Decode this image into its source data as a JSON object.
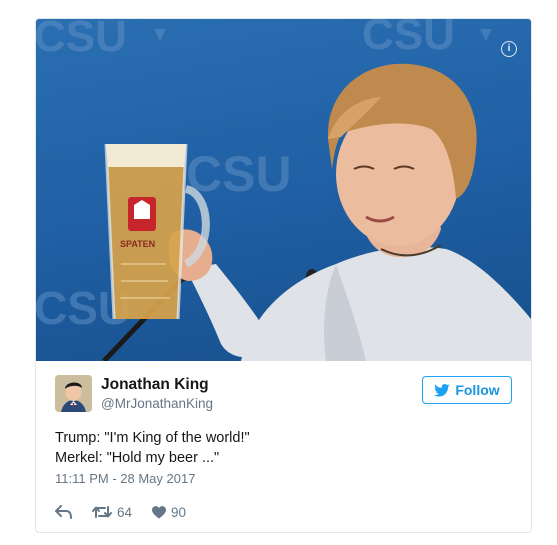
{
  "tweet": {
    "author_name": "Jonathan King",
    "author_handle": "@MrJonathanKing",
    "follow_label": "Follow",
    "text_line1": "Trump: \"I'm King of the world!\"",
    "text_line2": "Merkel: \"Hold my beer ...\"",
    "timestamp": "11:11 PM - 28 May 2017",
    "retweets": "64",
    "likes": "90"
  },
  "media": {
    "background_text": "CSU",
    "mug_label": "SPATEN"
  },
  "colors": {
    "accent": "#1da1f2",
    "background_blue": "#1f5ea2",
    "muted": "#657786"
  }
}
